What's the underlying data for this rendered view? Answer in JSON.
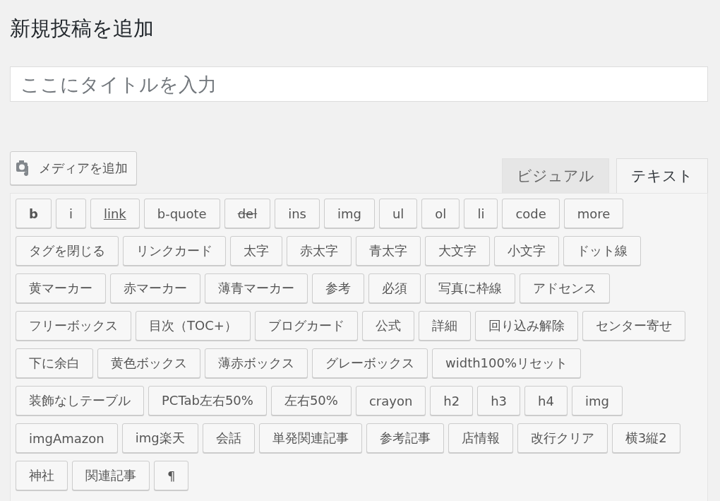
{
  "page_title": "新規投稿を追加",
  "title_field": {
    "placeholder": "ここにタイトルを入力"
  },
  "media_button": {
    "label": "メディアを追加"
  },
  "editor_tabs": [
    {
      "label": "ビジュアル",
      "selected": false
    },
    {
      "label": "テキスト",
      "selected": true
    }
  ],
  "quicktag_rows": [
    [
      {
        "label": "b",
        "kind": "bold"
      },
      {
        "label": "i",
        "kind": "plain"
      },
      {
        "label": "link",
        "kind": "link"
      },
      {
        "label": "b-quote",
        "kind": "plain"
      },
      {
        "label": "del",
        "kind": "del"
      },
      {
        "label": "ins",
        "kind": "plain"
      },
      {
        "label": "img",
        "kind": "plain"
      },
      {
        "label": "ul",
        "kind": "plain"
      },
      {
        "label": "ol",
        "kind": "plain"
      },
      {
        "label": "li",
        "kind": "plain"
      },
      {
        "label": "code",
        "kind": "plain"
      },
      {
        "label": "more",
        "kind": "plain"
      }
    ],
    [
      {
        "label": "タグを閉じる",
        "kind": "plain"
      },
      {
        "label": "リンクカード",
        "kind": "plain"
      },
      {
        "label": "太字",
        "kind": "plain"
      },
      {
        "label": "赤太字",
        "kind": "plain"
      },
      {
        "label": "青太字",
        "kind": "plain"
      },
      {
        "label": "大文字",
        "kind": "plain"
      },
      {
        "label": "小文字",
        "kind": "plain"
      },
      {
        "label": "ドット線",
        "kind": "plain"
      }
    ],
    [
      {
        "label": "黄マーカー",
        "kind": "plain"
      },
      {
        "label": "赤マーカー",
        "kind": "plain"
      },
      {
        "label": "薄青マーカー",
        "kind": "plain"
      },
      {
        "label": "参考",
        "kind": "plain"
      },
      {
        "label": "必須",
        "kind": "plain"
      },
      {
        "label": "写真に枠線",
        "kind": "plain"
      },
      {
        "label": "アドセンス",
        "kind": "plain"
      }
    ],
    [
      {
        "label": "フリーボックス",
        "kind": "plain"
      },
      {
        "label": "目次（TOC+）",
        "kind": "plain"
      },
      {
        "label": "ブログカード",
        "kind": "plain"
      },
      {
        "label": "公式",
        "kind": "plain"
      },
      {
        "label": "詳細",
        "kind": "plain"
      },
      {
        "label": "回り込み解除",
        "kind": "plain"
      },
      {
        "label": "センター寄せ",
        "kind": "plain"
      }
    ],
    [
      {
        "label": "下に余白",
        "kind": "plain"
      },
      {
        "label": "黄色ボックス",
        "kind": "plain"
      },
      {
        "label": "薄赤ボックス",
        "kind": "plain"
      },
      {
        "label": "グレーボックス",
        "kind": "plain"
      },
      {
        "label": "width100%リセット",
        "kind": "plain"
      }
    ],
    [
      {
        "label": "装飾なしテーブル",
        "kind": "plain"
      },
      {
        "label": "PCTab左右50%",
        "kind": "plain"
      },
      {
        "label": "左右50%",
        "kind": "plain"
      },
      {
        "label": "crayon",
        "kind": "plain"
      },
      {
        "label": "h2",
        "kind": "plain"
      },
      {
        "label": "h3",
        "kind": "plain"
      },
      {
        "label": "h4",
        "kind": "plain"
      },
      {
        "label": "img",
        "kind": "plain"
      }
    ],
    [
      {
        "label": "imgAmazon",
        "kind": "plain"
      },
      {
        "label": "img楽天",
        "kind": "plain"
      },
      {
        "label": "会話",
        "kind": "plain"
      },
      {
        "label": "単発関連記事",
        "kind": "plain"
      },
      {
        "label": "参考記事",
        "kind": "plain"
      },
      {
        "label": "店情報",
        "kind": "plain"
      },
      {
        "label": "改行クリア",
        "kind": "plain"
      },
      {
        "label": "横3縦2",
        "kind": "plain"
      }
    ],
    [
      {
        "label": "神社",
        "kind": "plain"
      },
      {
        "label": "関連記事",
        "kind": "plain"
      },
      {
        "label": "¶",
        "kind": "plain"
      }
    ]
  ]
}
